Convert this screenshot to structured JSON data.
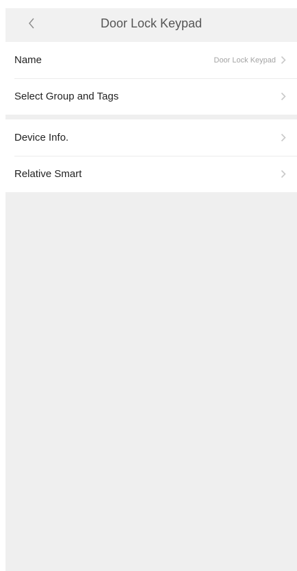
{
  "header": {
    "title": "Door Lock Keypad"
  },
  "settings": {
    "name_label": "Name",
    "name_value": "Door Lock Keypad",
    "group_label": "Select Group and Tags",
    "device_info_label": "Device Info.",
    "relative_smart_label": "Relative Smart"
  },
  "icons": {
    "back": "chevron-left-icon",
    "row_arrow": "chevron-right-icon"
  },
  "colors": {
    "background": "#efefef",
    "header_bg": "#f1f1f1",
    "row_bg": "#ffffff",
    "chevron": "#c8c8c8"
  }
}
